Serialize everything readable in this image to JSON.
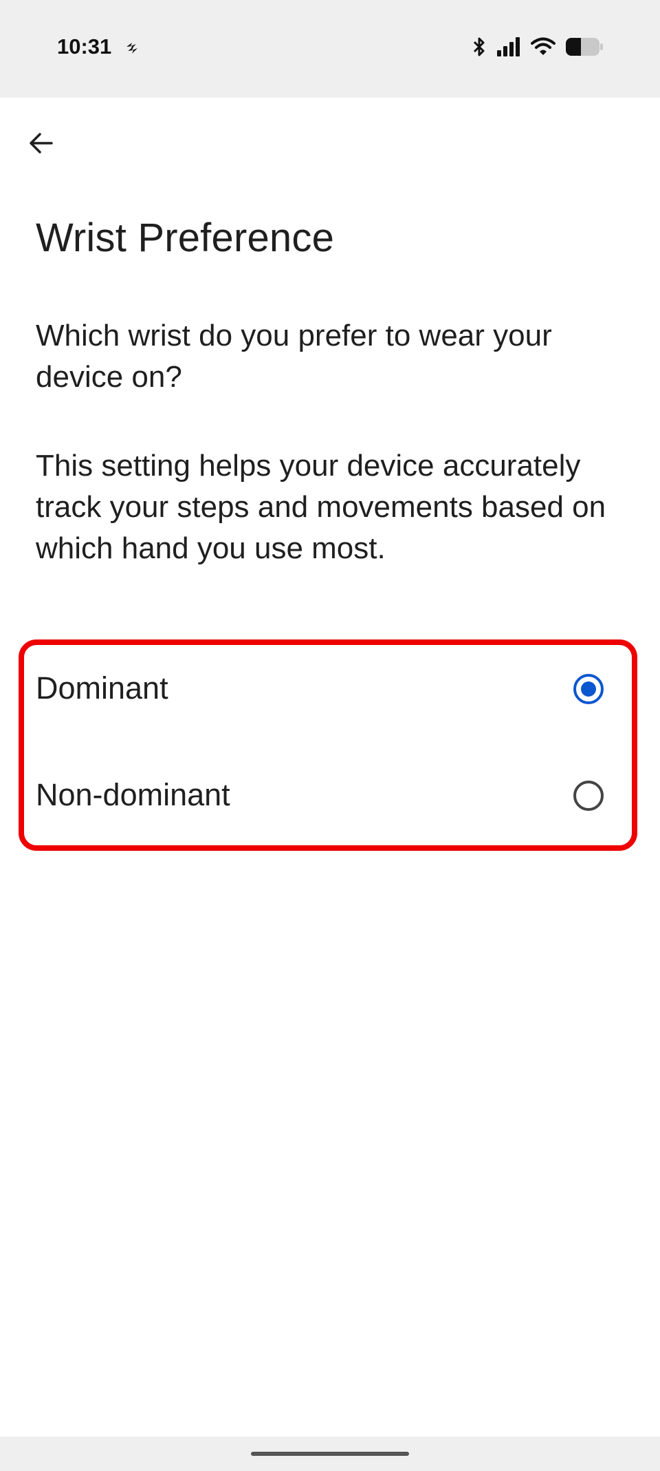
{
  "status_bar": {
    "time": "10:31",
    "left_icon": "app-notification-icon",
    "icons": [
      "bluetooth-icon",
      "signal-icon",
      "wifi-icon",
      "battery-icon"
    ]
  },
  "header": {
    "back_icon": "arrow-back-icon"
  },
  "page": {
    "title": "Wrist Preference",
    "question": "Which wrist do you prefer to wear your device on?",
    "description": "This setting helps your device accurately track your steps and movements based on which hand you use most."
  },
  "options": [
    {
      "label": "Dominant",
      "selected": true
    },
    {
      "label": "Non-dominant",
      "selected": false
    }
  ],
  "colors": {
    "accent": "#0b57d0",
    "highlight_border": "#ee0000",
    "text": "#1f1f1f"
  }
}
